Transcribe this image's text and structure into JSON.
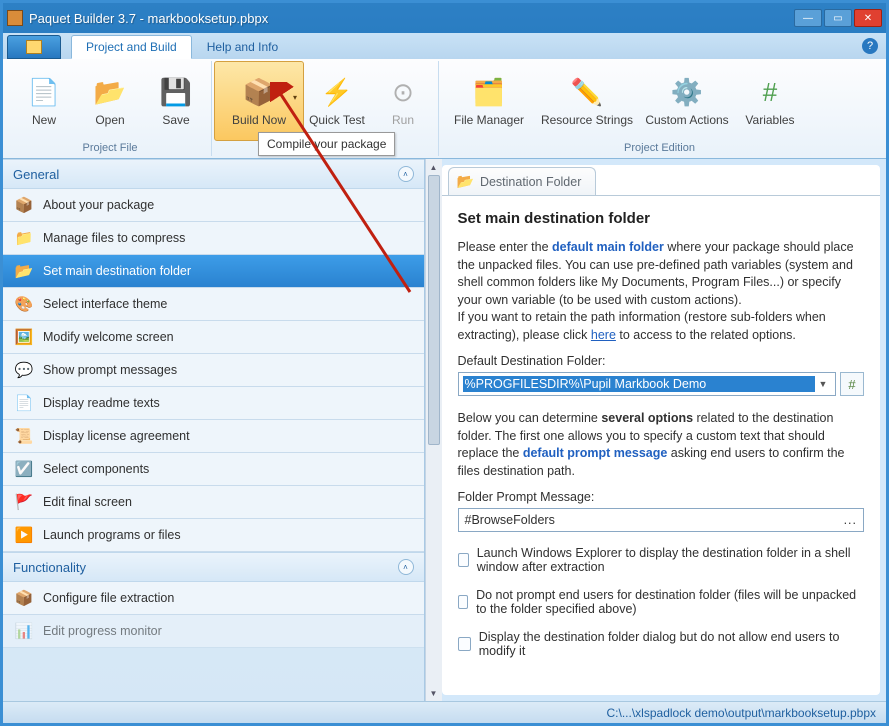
{
  "window": {
    "title": "Paquet Builder 3.7 - markbooksetup.pbpx"
  },
  "tabs": {
    "project": "Project and Build",
    "help": "Help and Info"
  },
  "ribbon": {
    "group_file": "Project File",
    "group_edition": "Project Edition",
    "new": "New",
    "open": "Open",
    "save": "Save",
    "build": "Build Now",
    "quick": "Quick Test",
    "run": "Run",
    "filemgr": "File Manager",
    "resstr": "Resource Strings",
    "custom": "Custom Actions",
    "vars": "Variables",
    "tooltip": "Compile your package"
  },
  "sidebar": {
    "general": "General",
    "functionality": "Functionality",
    "items_general": [
      "About your package",
      "Manage files to compress",
      "Set main destination folder",
      "Select interface theme",
      "Modify welcome screen",
      "Show prompt messages",
      "Display readme texts",
      "Display license agreement",
      "Select components",
      "Edit final screen",
      "Launch programs or files"
    ],
    "items_func": [
      "Configure file extraction",
      "Edit progress monitor"
    ]
  },
  "main": {
    "tab": "Destination Folder",
    "heading": "Set main destination folder",
    "intro1a": "Please enter the ",
    "intro1b": "default main folder",
    "intro1c": " where your package should place the unpacked files. You can use pre-defined path variables (system and shell common folders like My Documents, Program Files...) or specify your own variable (to be used with custom actions).",
    "intro2a": "If you want to retain the path information (restore sub-folders when extracting), please click ",
    "intro2b": "here",
    "intro2c": " to access to the related options.",
    "label_dest": "Default Destination Folder:",
    "value_dest": "%PROGFILESDIR%\\Pupil Markbook Demo",
    "below1a": "Below you can determine ",
    "below1b": "several options",
    "below1c": " related to the destination folder. The first one allows you to specify a custom text that should replace the ",
    "below1d": "default prompt message",
    "below1e": " asking end users to confirm the files destination path.",
    "label_prompt": "Folder Prompt Message:",
    "value_prompt": "#BrowseFolders",
    "chk1": "Launch Windows Explorer to display the destination folder in a shell window after extraction",
    "chk2": "Do not prompt end users for destination folder (files will be unpacked to the folder specified above)",
    "chk3": "Display the destination folder dialog but do not allow end users to modify it"
  },
  "statusbar": {
    "path": "C:\\...\\xlspadlock demo\\output\\markbooksetup.pbpx"
  }
}
